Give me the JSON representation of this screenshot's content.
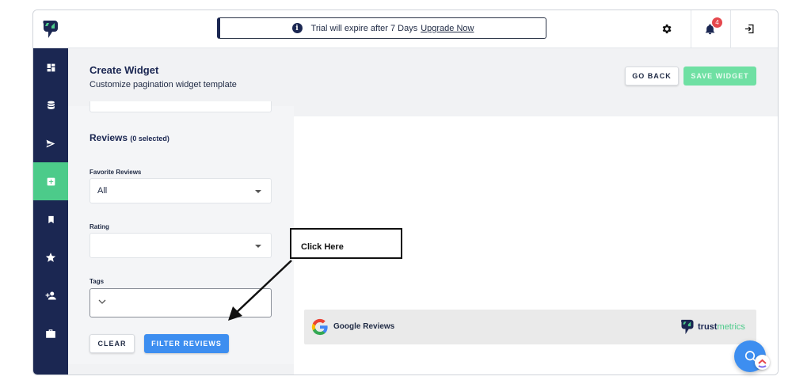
{
  "header": {
    "trial_text": "Trial will expire after 7 Days",
    "upgrade_link": "Upgrade Now",
    "notification_count": "4"
  },
  "sidebar": {
    "items": [
      {
        "icon": "dashboard-icon"
      },
      {
        "icon": "database-icon"
      },
      {
        "icon": "send-icon"
      },
      {
        "icon": "widget-icon",
        "active": true
      },
      {
        "icon": "bookmark-icon"
      },
      {
        "icon": "star-icon"
      },
      {
        "icon": "add-user-icon"
      },
      {
        "icon": "briefcase-icon"
      }
    ]
  },
  "page": {
    "title": "Create Widget",
    "subtitle": "Customize pagination widget template",
    "go_back_label": "GO BACK",
    "save_label": "SAVE WIDGET"
  },
  "filters": {
    "section_title": "Reviews",
    "selected_count": "(0 selected)",
    "favorite_label": "Favorite Reviews",
    "favorite_value": "All",
    "rating_label": "Rating",
    "rating_value": "",
    "tags_label": "Tags",
    "clear_label": "CLEAR",
    "filter_label": "FILTER REVIEWS"
  },
  "preview": {
    "source_label": "Google Reviews",
    "brand_trust": "trust",
    "brand_metrics": "metrics"
  },
  "annotation": {
    "callout_text": "Click Here"
  },
  "colors": {
    "sidebar": "#1b2752",
    "accent_green": "#4ccb8a",
    "primary_blue": "#3d8ef0",
    "badge_red": "#e5484d"
  }
}
